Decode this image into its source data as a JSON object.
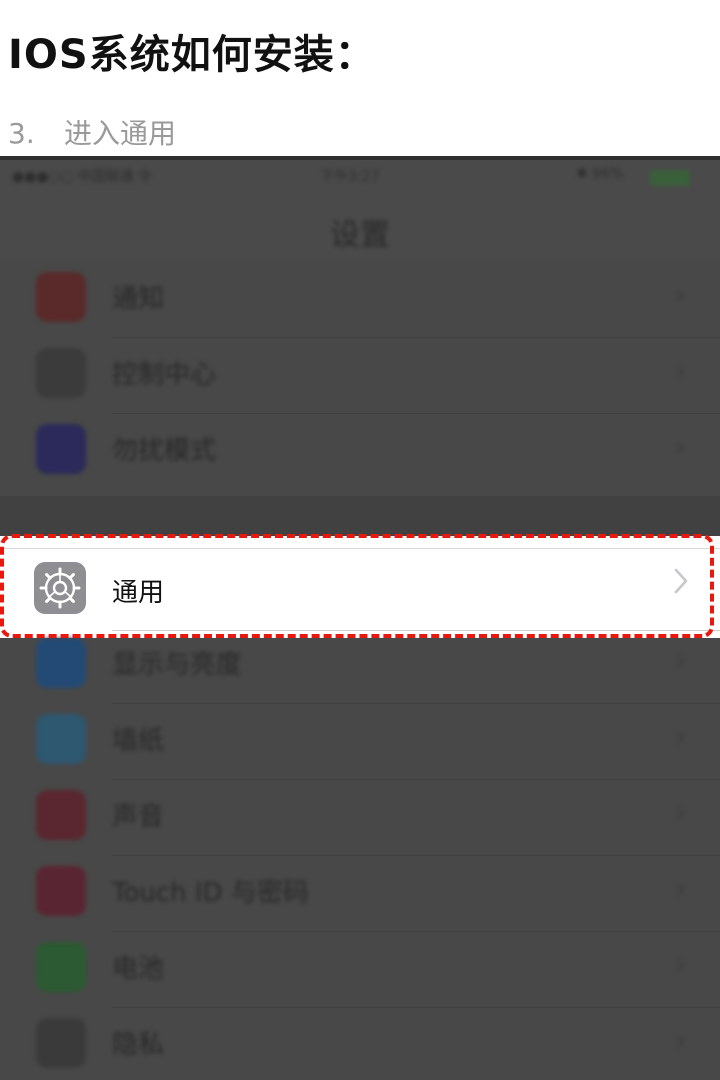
{
  "header": {
    "title": "IOS系统如何安装：",
    "step_number": "3.",
    "step_text": "进入通用"
  },
  "screenshot": {
    "status_bar": {
      "carrier": "●●●○○ 中国联通 令",
      "time": "下午3:27",
      "battery": "✱ 96%"
    },
    "nav_title": "设置",
    "rows": [
      {
        "label": "通知",
        "icon": "notifications-icon",
        "color": "#5a2a2a"
      },
      {
        "label": "控制中心",
        "icon": "control-center-icon",
        "color": "#3b3b3b"
      },
      {
        "label": "勿扰模式",
        "icon": "do-not-disturb-icon",
        "color": "#2c2a5a"
      },
      {
        "label": "显示与亮度",
        "icon": "display-brightness-icon",
        "color": "#234a75"
      },
      {
        "label": "墙纸",
        "icon": "wallpaper-icon",
        "color": "#2e5770"
      },
      {
        "label": "声音",
        "icon": "sounds-icon",
        "color": "#5a2730"
      },
      {
        "label": "Touch ID 与密码",
        "icon": "touch-id-icon",
        "color": "#5a2533"
      },
      {
        "label": "电池",
        "icon": "battery-icon",
        "color": "#2c5a32"
      },
      {
        "label": "隐私",
        "icon": "privacy-icon",
        "color": "#3a3a3a"
      }
    ],
    "highlighted_row": {
      "label": "通用",
      "icon": "gear-icon"
    },
    "highlight_color": "#e8180e"
  }
}
